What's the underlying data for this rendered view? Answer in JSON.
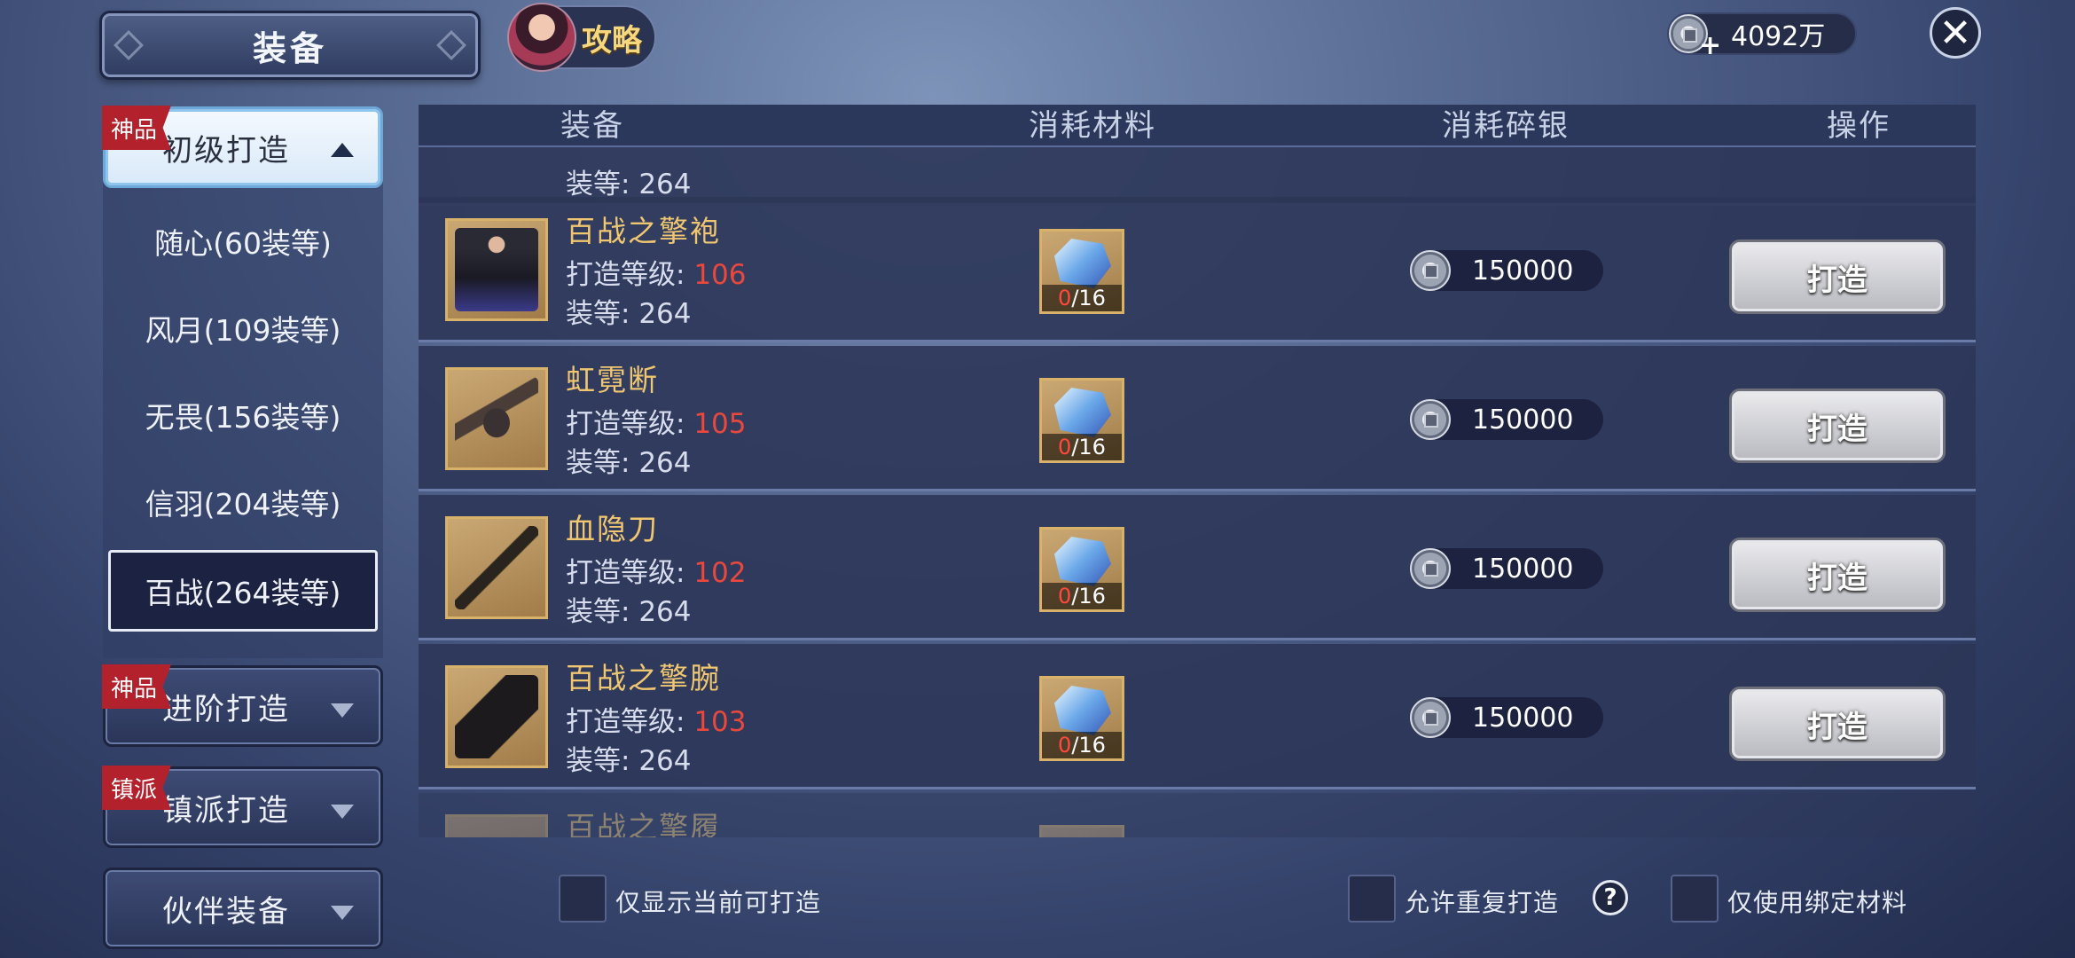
{
  "header": {
    "title": "装备",
    "guide_label": "攻略",
    "silver_amount": "4092万"
  },
  "sidebar": {
    "categories": [
      {
        "label": "初级打造",
        "badge": "神品"
      },
      {
        "label": "进阶打造",
        "badge": "神品"
      },
      {
        "label": "镇派打造",
        "badge": "镇派"
      },
      {
        "label": "伙伴装备",
        "badge": ""
      }
    ],
    "subitems": [
      "随心(60装等)",
      "风月(109装等)",
      "无畏(156装等)",
      "信羽(204装等)",
      "百战(264装等)"
    ]
  },
  "table": {
    "headers": [
      "装备",
      "消耗材料",
      "消耗碎银",
      "操作"
    ],
    "level_label": "打造等级: ",
    "ilvl_label": "装等: ",
    "partial_top": {
      "ilvl": "264"
    },
    "rows": [
      {
        "name": "百战之擎袍",
        "level": "106",
        "ilvl": "264",
        "mat_have": "0",
        "mat_need": "/16",
        "cost": "150000",
        "action": "打造",
        "icon": "robe-icon"
      },
      {
        "name": "虹霓断",
        "level": "105",
        "ilvl": "264",
        "mat_have": "0",
        "mat_need": "/16",
        "cost": "150000",
        "action": "打造",
        "icon": "bird-weapon-icon"
      },
      {
        "name": "血隐刀",
        "level": "102",
        "ilvl": "264",
        "mat_have": "0",
        "mat_need": "/16",
        "cost": "150000",
        "action": "打造",
        "icon": "blade-icon"
      },
      {
        "name": "百战之擎腕",
        "level": "103",
        "ilvl": "264",
        "mat_have": "0",
        "mat_need": "/16",
        "cost": "150000",
        "action": "打造",
        "icon": "bracer-icon"
      }
    ],
    "partial_bottom": {
      "name": "百战之擎履"
    }
  },
  "footer": {
    "only_craftable": "仅显示当前可打造",
    "allow_repeat": "允许重复打造",
    "help": "?",
    "bound_only": "仅使用绑定材料"
  }
}
